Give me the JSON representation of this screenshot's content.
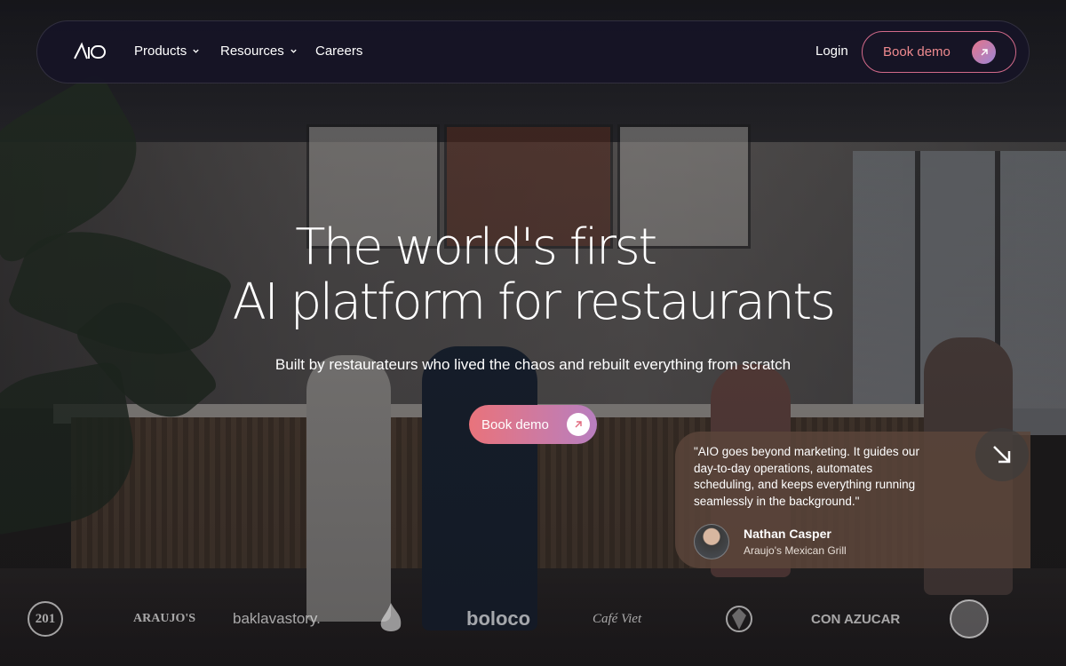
{
  "nav": {
    "logo_text": "AIO",
    "items": [
      {
        "label": "Products",
        "has_dropdown": true
      },
      {
        "label": "Resources",
        "has_dropdown": true
      },
      {
        "label": "Careers",
        "has_dropdown": false
      }
    ],
    "login_label": "Login",
    "book_demo_label": "Book demo",
    "accent_color": "#ef8a8f"
  },
  "hero": {
    "title_line1": "The world's first",
    "title_line2": "AI platform for restaurants",
    "subtitle": "Built by restaurateurs who lived the chaos and rebuilt everything from scratch",
    "cta_label": "Book demo"
  },
  "testimonial": {
    "quote": "\"AIO goes beyond marketing. It guides our day-to-day operations, automates scheduling, and keeps everything running seamlessly in the background.\"",
    "name": "Nathan Casper",
    "business": "Araujo's Mexican Grill",
    "next_icon": "arrow-down-right-icon"
  },
  "logos": [
    {
      "name": "201",
      "label": "201"
    },
    {
      "name": "araujos",
      "label": "ARAUJO'S"
    },
    {
      "name": "baklavastory",
      "label": "baklavastory."
    },
    {
      "name": "flame-logo",
      "label": ""
    },
    {
      "name": "boloco",
      "label": "boloco"
    },
    {
      "name": "script-logo",
      "label": "Café Viet"
    },
    {
      "name": "mascot-logo",
      "label": ""
    },
    {
      "name": "con-azucar",
      "label": "CON AZUCAR"
    },
    {
      "name": "round-badge-logo",
      "label": ""
    }
  ]
}
